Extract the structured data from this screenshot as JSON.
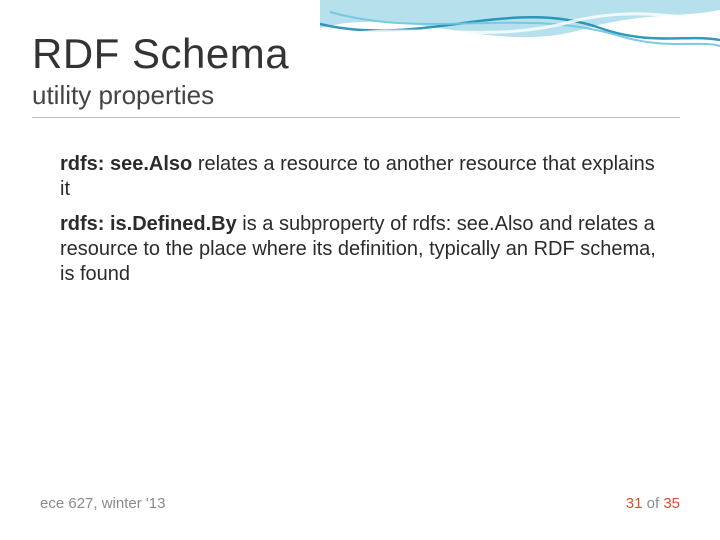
{
  "header": {
    "title": "RDF Schema",
    "subtitle": "utility properties"
  },
  "body": {
    "p1_b": "rdfs: see.Also",
    "p1_t": " relates a resource to another resource that explains it",
    "p2_b": "rdfs: is.Defined.By",
    "p2_t1": " is a subproperty of rdfs: see.Also and relates a resource to the place where its definition, typically an RDF schema, is found"
  },
  "footer": {
    "left": "ece 627, winter '13",
    "page_current": "31",
    "page_sep": " of ",
    "page_total": "35"
  }
}
